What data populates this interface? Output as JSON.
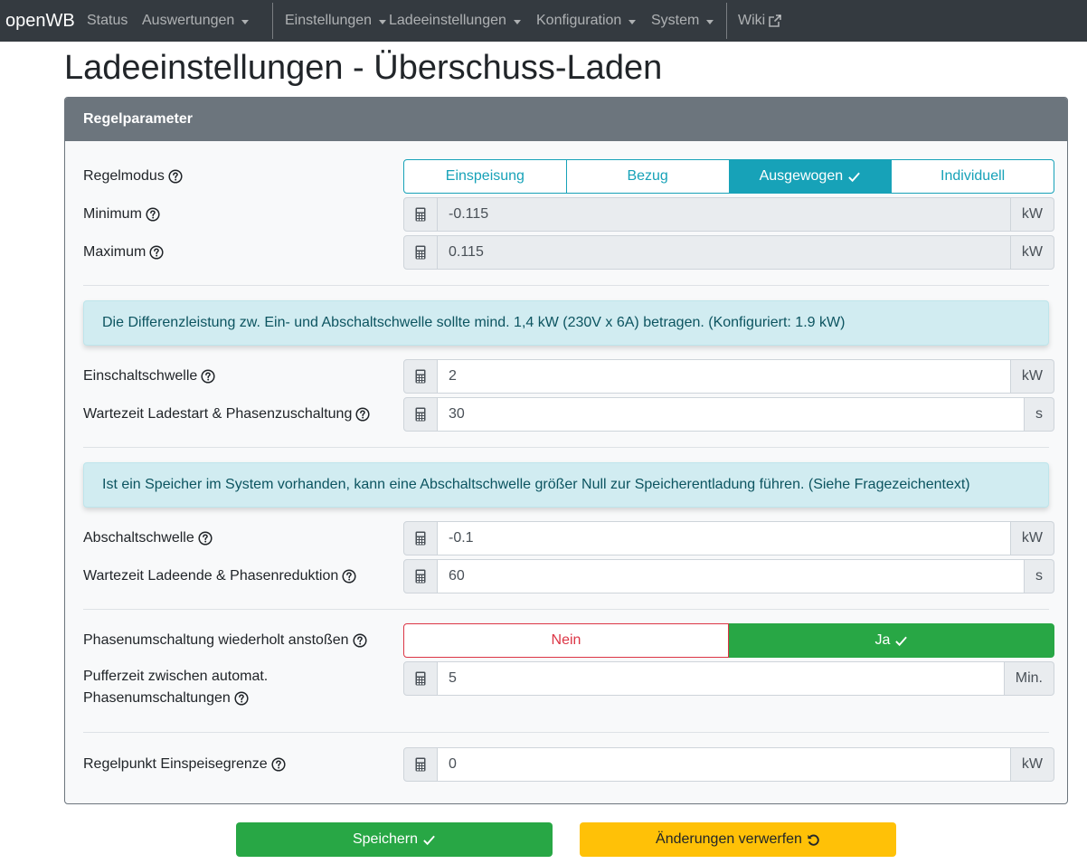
{
  "nav": {
    "brand": "openWB",
    "items": [
      "Status",
      "Auswertungen",
      "Einstellungen",
      "Ladeeinstellungen",
      "Konfiguration",
      "System",
      "Wiki"
    ]
  },
  "page_title": "Ladeeinstellungen - Überschuss-Laden",
  "card": {
    "header": "Regelparameter",
    "regelmodus": {
      "label": "Regelmodus",
      "options": [
        "Einspeisung",
        "Bezug",
        "Ausgewogen",
        "Individuell"
      ],
      "selected": "Ausgewogen"
    },
    "minimum": {
      "label": "Minimum",
      "value": "-0.115",
      "unit": "kW"
    },
    "maximum": {
      "label": "Maximum",
      "value": "0.115",
      "unit": "kW"
    },
    "alert1": "Die Differenzleistung zw. Ein- und Abschaltschwelle sollte mind. 1,4 kW (230V x 6A) betragen. (Konfiguriert: 1.9 kW)",
    "einschaltschwelle": {
      "label": "Einschaltschwelle",
      "value": "2",
      "unit": "kW"
    },
    "wartezeit_start": {
      "label": "Wartezeit Ladestart & Phasenzuschaltung",
      "value": "30",
      "unit": "s"
    },
    "alert2": "Ist ein Speicher im System vorhanden, kann eine Abschaltschwelle größer Null zur Speicherentladung führen. (Siehe Fragezeichentext)",
    "abschaltschwelle": {
      "label": "Abschaltschwelle",
      "value": "-0.1",
      "unit": "kW"
    },
    "wartezeit_ende": {
      "label": "Wartezeit Ladeende & Phasenreduktion",
      "value": "60",
      "unit": "s"
    },
    "phasenumschaltung": {
      "label": "Phasenumschaltung wiederholt anstoßen",
      "no": "Nein",
      "yes": "Ja",
      "selected": "Ja"
    },
    "pufferzeit": {
      "label_line1": "Pufferzeit zwischen automat.",
      "label_line2": "Phasenumschaltungen",
      "value": "5",
      "unit": "Min."
    },
    "regelpunkt": {
      "label": "Regelpunkt Einspeisegrenze",
      "value": "0",
      "unit": "kW"
    }
  },
  "buttons": {
    "save": "Speichern",
    "discard": "Änderungen verwerfen"
  },
  "colors": {
    "navbar": "#343a40",
    "info": "#17a2b8",
    "success": "#28a745",
    "warning": "#ffc107",
    "danger": "#dc3545",
    "header": "#6c757d"
  }
}
